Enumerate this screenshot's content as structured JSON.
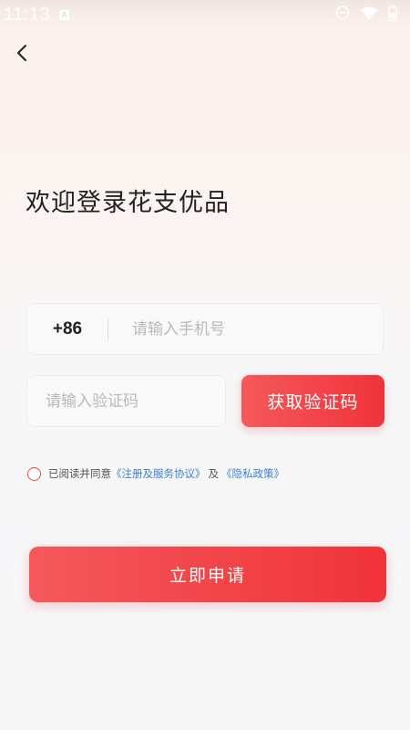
{
  "status_bar": {
    "time": "11:13",
    "notification_glyph": "A",
    "icons": [
      "dnd-icon",
      "wifi-icon",
      "battery-icon"
    ]
  },
  "header": {
    "back_icon": "chevron-left-icon"
  },
  "login": {
    "title": "欢迎登录花支优品",
    "country_code": "+86",
    "phone_placeholder": "请输入手机号",
    "phone_value": "",
    "code_placeholder": "请输入验证码",
    "code_value": "",
    "get_code_label": "获取验证码",
    "agreement": {
      "checked": false,
      "prefix": "已阅读并同意",
      "terms_link": "《注册及服务协议》",
      "conjunction": "及",
      "privacy_link": "《隐私政策》"
    },
    "submit_label": "立即申请"
  },
  "colors": {
    "accent": "#F0383E",
    "link": "#3D7FD6",
    "text": "#222222",
    "placeholder": "#B9B9BD"
  }
}
